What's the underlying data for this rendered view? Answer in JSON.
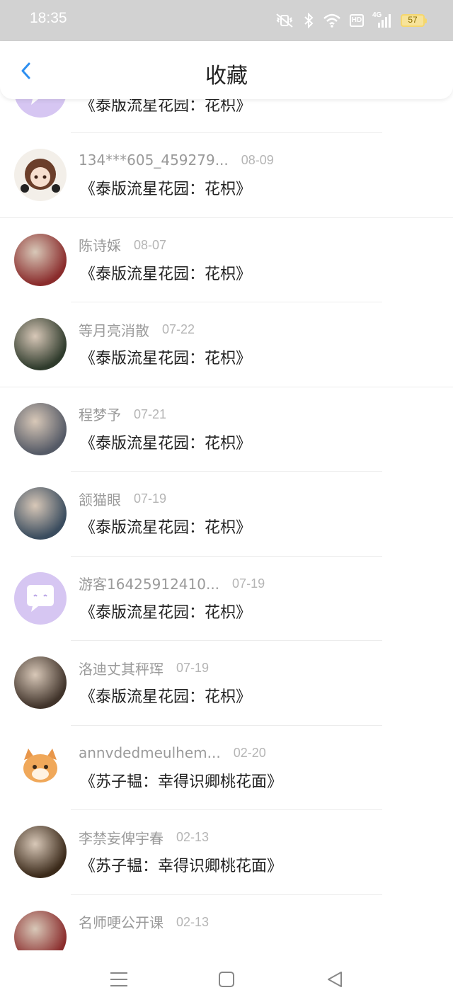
{
  "status_bar": {
    "time": "18:35",
    "hd_label": "HD",
    "network_label": "4G",
    "battery_level": "57"
  },
  "header": {
    "title": "收藏"
  },
  "items": [
    {
      "user": "",
      "date": "",
      "title": "《泰版流星花园：花枳》",
      "avatar": "chat-bubble-avatar",
      "divider": "short"
    },
    {
      "user": "134***605_459279...",
      "date": "08-09",
      "title": "《泰版流星花园：花枳》",
      "avatar": "anime-girl-avatar",
      "divider": "full"
    },
    {
      "user": "陈诗婇",
      "date": "08-07",
      "title": "《泰版流星花园：花枳》",
      "avatar": "photo-avatar",
      "divider": "short"
    },
    {
      "user": "等月亮消散",
      "date": "07-22",
      "title": "《泰版流星花园：花枳》",
      "avatar": "photo-avatar",
      "divider": "full"
    },
    {
      "user": "程梦予",
      "date": "07-21",
      "title": "《泰版流星花园：花枳》",
      "avatar": "photo-avatar",
      "divider": "short"
    },
    {
      "user": "颔猫眼",
      "date": "07-19",
      "title": "《泰版流星花园：花枳》",
      "avatar": "photo-avatar",
      "divider": "short"
    },
    {
      "user": "游客16425912410...",
      "date": "07-19",
      "title": "《泰版流星花园：花枳》",
      "avatar": "chat-bubble-avatar",
      "divider": "short"
    },
    {
      "user": "洛迪丈其秤珲",
      "date": "07-19",
      "title": "《泰版流星花园：花枳》",
      "avatar": "photo-avatar",
      "divider": "short"
    },
    {
      "user": "annvdedmeulhem...",
      "date": "02-20",
      "title": "《苏子韫：幸得识卿桃花面》",
      "avatar": "cat-avatar",
      "divider": "short"
    },
    {
      "user": "李禁妄俾宇春",
      "date": "02-13",
      "title": "《苏子韫：幸得识卿桃花面》",
      "avatar": "photo-avatar",
      "divider": "short"
    },
    {
      "user": "名师哽公开课",
      "date": "02-13",
      "title": "",
      "avatar": "photo-avatar",
      "divider": "none"
    }
  ],
  "nav_bar": {
    "menu_icon": "menu-icon",
    "home_icon": "home-icon",
    "back_icon": "back-triangle-icon"
  },
  "colors": {
    "accent": "#2e8ff0",
    "chat_avatar_bg": "#d6c6f2",
    "status_bar_bg": "#d2d2d2"
  }
}
